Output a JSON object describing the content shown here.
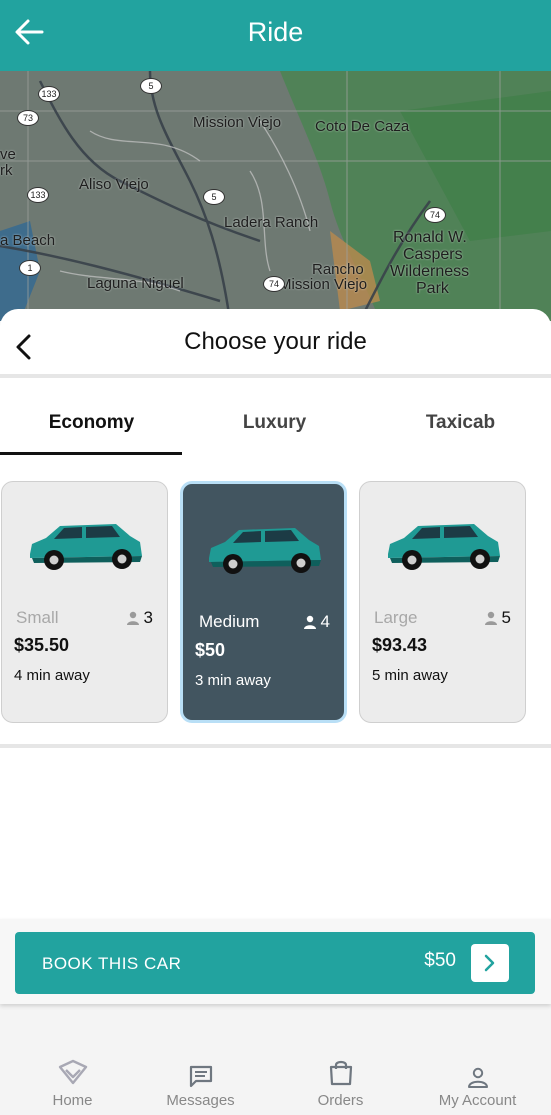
{
  "header": {
    "title": "Ride",
    "back_icon": "arrow-left-icon"
  },
  "map": {
    "labels": [
      "Mission Viejo",
      "Coto De Caza",
      "ve",
      "rk",
      "Aliso Viejo",
      "Ladera Ranch",
      "Ronald W.",
      "Caspers",
      "Wilderness",
      "Park",
      "a Beach",
      "Rancho",
      "Mission Viejo",
      "Laguna Niguel"
    ],
    "shields": [
      "133",
      "5",
      "73",
      "133",
      "5",
      "74",
      "1",
      "74"
    ]
  },
  "sheet": {
    "title": "Choose your ride",
    "tabs": [
      "Economy",
      "Luxury",
      "Taxicab"
    ],
    "active_tab": "Economy"
  },
  "cars": [
    {
      "size": "Small",
      "capacity": "3",
      "price": "$35.50",
      "eta": "4 min away",
      "selected": false
    },
    {
      "size": "Medium",
      "capacity": "4",
      "price": "$50",
      "eta": "3 min away",
      "selected": true
    },
    {
      "size": "Large",
      "capacity": "5",
      "price": "$93.43",
      "eta": "5 min away",
      "selected": false
    }
  ],
  "book": {
    "label": "BOOK THIS CAR",
    "amount": "$50"
  },
  "nav": [
    {
      "label": "Home",
      "icon": "home-logo-icon"
    },
    {
      "label": "Messages",
      "icon": "message-icon"
    },
    {
      "label": "Orders",
      "icon": "shopping-bag-icon"
    },
    {
      "label": "My Account",
      "icon": "person-icon"
    }
  ],
  "colors": {
    "primary": "#22a39f",
    "selected_card": "#425560",
    "selected_border": "#b9dff6"
  }
}
